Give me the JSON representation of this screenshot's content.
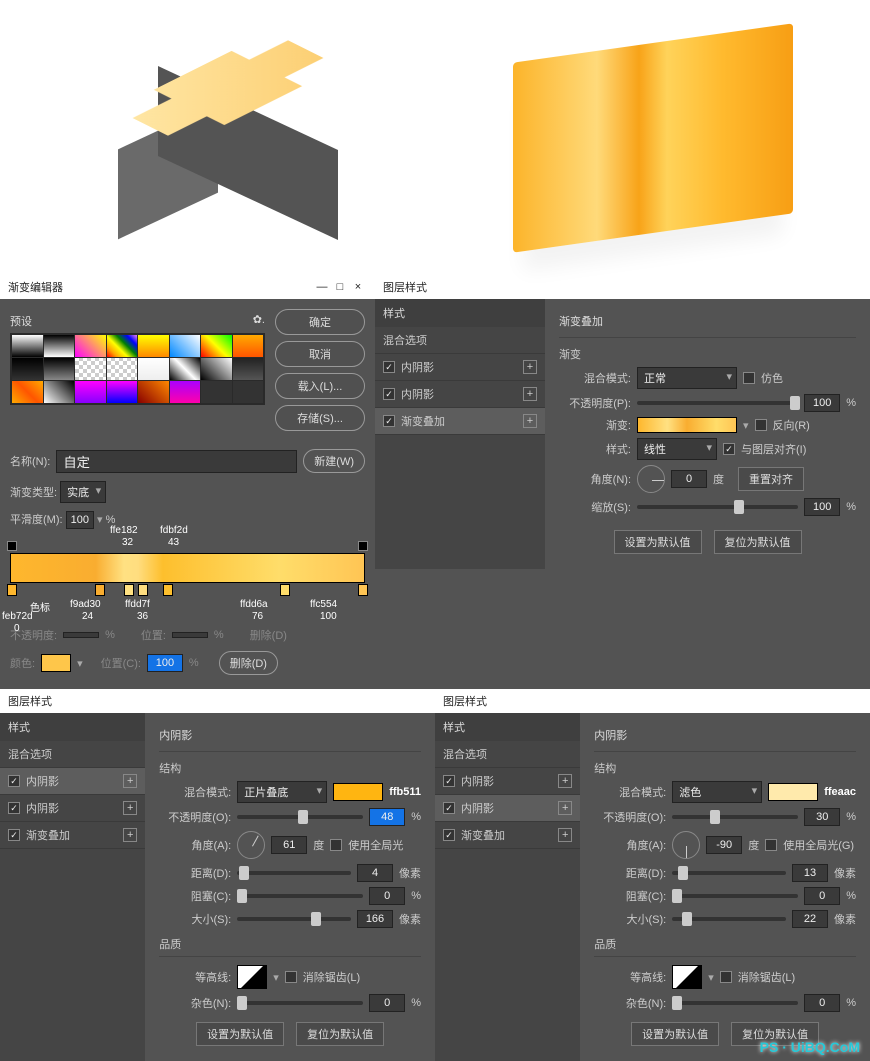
{
  "top": {},
  "gradient_editor": {
    "title": "渐变编辑器",
    "min": "—",
    "max": "□",
    "close": "×",
    "presets_label": "预设",
    "gear": "✿",
    "buttons": {
      "ok": "确定",
      "cancel": "取消",
      "load": "载入(L)...",
      "save": "存储(S)..."
    },
    "name_label": "名称(N):",
    "name_value": "自定",
    "new_btn": "新建(W)",
    "type_label": "渐变类型:",
    "type_value": "实底",
    "smooth_label": "平滑度(M):",
    "smooth_value": "100",
    "smooth_unit": "%",
    "stops_top": [
      {
        "hex": "ffe182",
        "pos": "32"
      },
      {
        "hex": "fdbf2d",
        "pos": "43"
      }
    ],
    "stops_bottom": [
      {
        "hex": "feb72d",
        "pos": "0",
        "lbl": "色标"
      },
      {
        "hex": "f9ad30",
        "pos": "24"
      },
      {
        "hex": "ffdd7f",
        "pos": "36"
      },
      {
        "hex": "ffdd6a",
        "pos": "76"
      },
      {
        "hex": "ffc554",
        "pos": "100"
      }
    ],
    "row_opacity": {
      "label": "不透明度:",
      "loc_label": "位置:",
      "unit": "%",
      "delete": "删除(D)"
    },
    "row_color": {
      "label": "颜色:",
      "loc_label": "位置(C):",
      "loc_value": "100",
      "unit": "%",
      "delete": "删除(D)"
    }
  },
  "layer_style_top": {
    "title": "图层样式",
    "style_head": "样式",
    "blend_head": "混合选项",
    "items": [
      {
        "label": "内阴影",
        "checked": true
      },
      {
        "label": "内阴影",
        "checked": true
      },
      {
        "label": "渐变叠加",
        "checked": true,
        "selected": true
      }
    ],
    "section": "渐变叠加",
    "sub": "渐变",
    "blend_mode_label": "混合模式:",
    "blend_mode_value": "正常",
    "dither_label": "仿色",
    "opacity_label": "不透明度(P):",
    "opacity_value": "100",
    "opacity_unit": "%",
    "gradient_label": "渐变:",
    "reverse_label": "反向(R)",
    "style_label": "样式:",
    "style_value": "线性",
    "align_label": "与图层对齐(I)",
    "angle_label": "角度(N):",
    "angle_value": "0",
    "angle_unit": "度",
    "reset_align": "重置对齐",
    "scale_label": "缩放(S):",
    "scale_value": "100",
    "scale_unit": "%",
    "set_default": "设置为默认值",
    "reset_default": "复位为默认值"
  },
  "inner_shadow_left": {
    "title": "图层样式",
    "style_head": "样式",
    "blend_head": "混合选项",
    "items": [
      {
        "label": "内阴影",
        "checked": true,
        "selected": true
      },
      {
        "label": "内阴影",
        "checked": true
      },
      {
        "label": "渐变叠加",
        "checked": true
      }
    ],
    "section": "内阴影",
    "structure": "结构",
    "blend_mode_label": "混合模式:",
    "blend_mode_value": "正片叠底",
    "color_hex": "ffb511",
    "opacity_label": "不透明度(O):",
    "opacity_value": "48",
    "opacity_unit": "%",
    "angle_label": "角度(A):",
    "angle_value": "61",
    "angle_unit": "度",
    "global_label": "使用全局光",
    "distance_label": "距离(D):",
    "distance_value": "4",
    "distance_unit": "像素",
    "choke_label": "阻塞(C):",
    "choke_value": "0",
    "choke_unit": "%",
    "size_label": "大小(S):",
    "size_value": "166",
    "size_unit": "像素",
    "quality": "品质",
    "contour_label": "等高线:",
    "antialias_label": "消除锯齿(L)",
    "noise_label": "杂色(N):",
    "noise_value": "0",
    "noise_unit": "%",
    "set_default": "设置为默认值",
    "reset_default": "复位为默认值"
  },
  "inner_shadow_right": {
    "title": "图层样式",
    "style_head": "样式",
    "blend_head": "混合选项",
    "items": [
      {
        "label": "内阴影",
        "checked": true
      },
      {
        "label": "内阴影",
        "checked": true,
        "selected": true
      },
      {
        "label": "渐变叠加",
        "checked": true
      }
    ],
    "section": "内阴影",
    "structure": "结构",
    "blend_mode_label": "混合模式:",
    "blend_mode_value": "滤色",
    "color_hex": "ffeaac",
    "opacity_label": "不透明度(O):",
    "opacity_value": "30",
    "opacity_unit": "%",
    "angle_label": "角度(A):",
    "angle_value": "-90",
    "angle_unit": "度",
    "global_label": "使用全局光(G)",
    "distance_label": "距离(D):",
    "distance_value": "13",
    "distance_unit": "像素",
    "choke_label": "阻塞(C):",
    "choke_value": "0",
    "choke_unit": "%",
    "size_label": "大小(S):",
    "size_value": "22",
    "size_unit": "像素",
    "quality": "品质",
    "contour_label": "等高线:",
    "antialias_label": "消除锯齿(L)",
    "noise_label": "杂色(N):",
    "noise_value": "0",
    "noise_unit": "%",
    "set_default": "设置为默认值",
    "reset_default": "复位为默认值",
    "watermark": "PS · UiBQ.CoM"
  }
}
